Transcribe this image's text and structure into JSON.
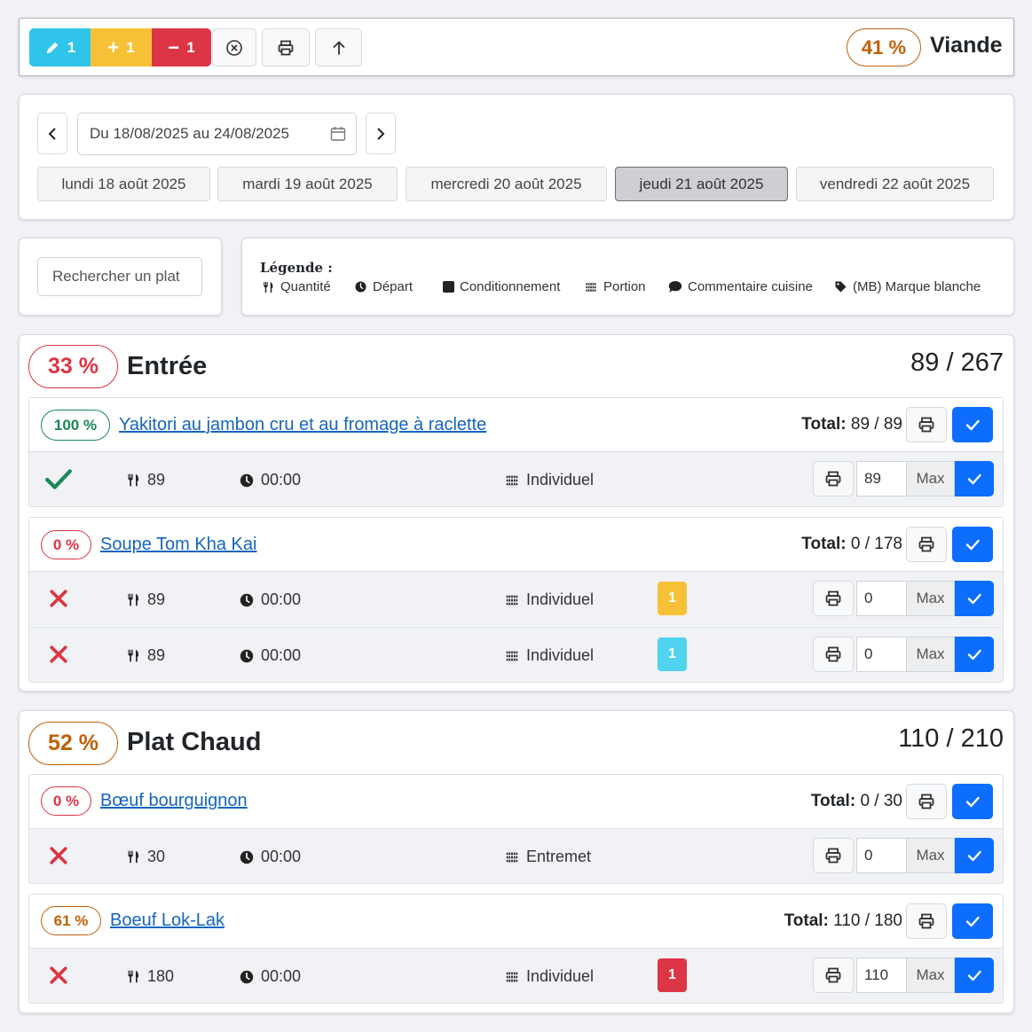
{
  "toolbar": {
    "edit_count": "1",
    "add_count": "1",
    "remove_count": "1",
    "percent": "41 %",
    "title": "Viande"
  },
  "date_nav": {
    "range": "Du 18/08/2025 au 24/08/2025",
    "days": [
      {
        "label": "lundi 18 août 2025",
        "active": false
      },
      {
        "label": "mardi 19 août 2025",
        "active": false
      },
      {
        "label": "mercredi 20 août 2025",
        "active": false
      },
      {
        "label": "jeudi 21 août 2025",
        "active": true
      },
      {
        "label": "vendredi 22 août 2025",
        "active": false
      }
    ]
  },
  "search": {
    "placeholder": "Rechercher un plat"
  },
  "legend": {
    "title": "Légende :",
    "items": [
      "Quantité",
      "Départ",
      "Conditionnement",
      "Portion",
      "Commentaire cuisine",
      "(MB) Marque blanche"
    ]
  },
  "colors": {
    "primary": "#0d6efd",
    "info": "#30c4ea",
    "warning": "#f7c137",
    "danger": "#dc3545",
    "success": "#198754",
    "orange": "#c0600a"
  },
  "sections": [
    {
      "percent": "33 %",
      "title": "Entrée",
      "count": "89 / 267",
      "dishes": [
        {
          "percent": "100 %",
          "name": "Yakitori au jambon cru et au fromage à raclette",
          "total_label": "Total:",
          "total": "89 / 89",
          "rows": [
            {
              "status": "done",
              "qty": "89",
              "time": "00:00",
              "portion": "Individuel",
              "input": "89",
              "max": "Max"
            }
          ]
        },
        {
          "percent": "0 %",
          "name": "Soupe Tom Kha Kai",
          "total_label": "Total:",
          "total": "0 / 178",
          "rows": [
            {
              "status": "todo",
              "qty": "89",
              "time": "00:00",
              "portion": "Individuel",
              "tag": "1",
              "input": "0",
              "max": "Max"
            },
            {
              "status": "todo",
              "qty": "89",
              "time": "00:00",
              "portion": "Individuel",
              "tag": "1",
              "input": "0",
              "max": "Max"
            }
          ]
        }
      ]
    },
    {
      "percent": "52 %",
      "title": "Plat Chaud",
      "count": "110 / 210",
      "dishes": [
        {
          "percent": "0 %",
          "name": "Bœuf bourguignon",
          "total_label": "Total:",
          "total": "0 / 30",
          "rows": [
            {
              "status": "todo",
              "qty": "30",
              "time": "00:00",
              "portion": "Entremet",
              "input": "0",
              "max": "Max"
            }
          ]
        },
        {
          "percent": "61 %",
          "name": "Boeuf Lok-Lak",
          "total_label": "Total:",
          "total": "110 / 180",
          "rows": [
            {
              "status": "todo",
              "qty": "180",
              "time": "00:00",
              "portion": "Individuel",
              "tag": "1",
              "input": "110",
              "max": "Max"
            }
          ]
        }
      ]
    }
  ]
}
